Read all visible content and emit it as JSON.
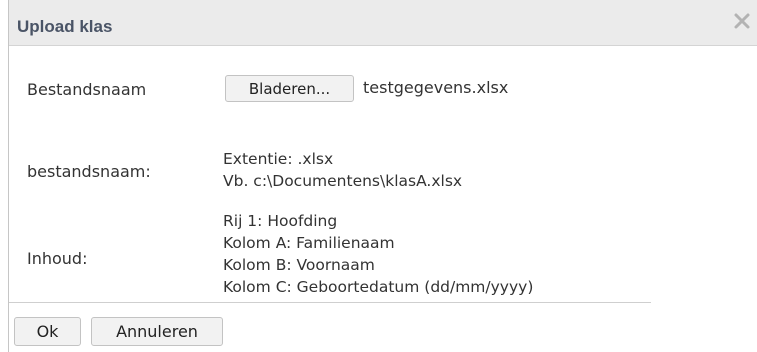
{
  "dialog": {
    "title": "Upload klas",
    "close_icon": "close-icon"
  },
  "file_row": {
    "label": "Bestandsnaam",
    "browse_label": "Bladeren...",
    "filename": "testgegevens.xlsx"
  },
  "name_row": {
    "label": "bestandsnaam:",
    "lines": [
      "Extentie: .xlsx",
      "Vb. c:\\Documentens\\klasA.xlsx"
    ]
  },
  "content_row": {
    "label": "Inhoud:",
    "lines": [
      "Rij 1: Hoofding",
      "Kolom A: Familienaam",
      "Kolom B: Voornaam",
      "Kolom C: Geboortedatum (dd/mm/yyyy)"
    ]
  },
  "buttons": {
    "ok_label": "Ok",
    "cancel_label": "Annuleren"
  },
  "colors": {
    "titlebar": "#ebebeb",
    "title_text": "#4a5466",
    "button_bg": "#f2f2f2"
  }
}
